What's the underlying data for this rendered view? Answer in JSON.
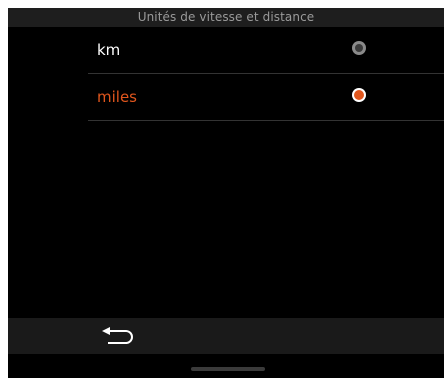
{
  "header": {
    "title": "Unités de vitesse et distance"
  },
  "options": [
    {
      "label": "km",
      "selected": false
    },
    {
      "label": "miles",
      "selected": true
    }
  ],
  "colors": {
    "accent": "#e0561d",
    "text": "#ffffff",
    "radio_inactive_outer": "#8a8a8a",
    "radio_inactive_inner": "#3a3a3a",
    "divider": "#333333"
  },
  "bottom_bar": {
    "back_icon": "back-arrow-icon"
  }
}
